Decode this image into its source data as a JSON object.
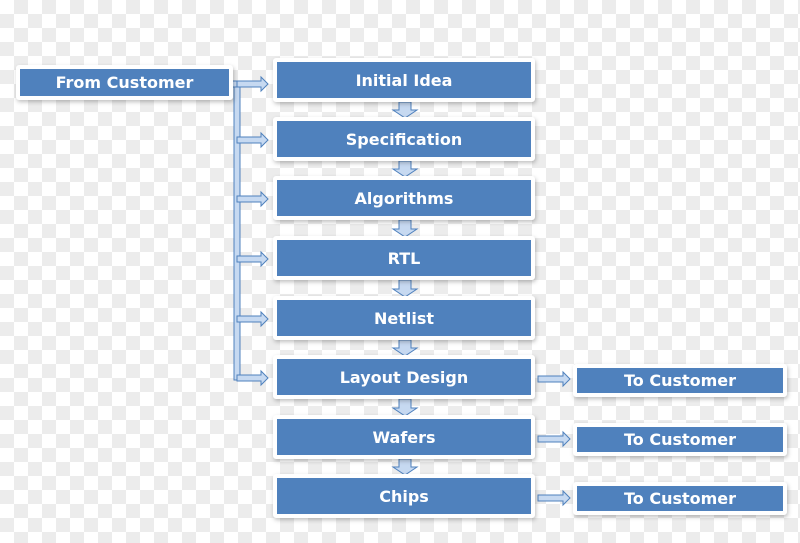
{
  "source": {
    "label": "From Customer"
  },
  "steps": [
    {
      "label": "Initial Idea"
    },
    {
      "label": "Specification"
    },
    {
      "label": "Algorithms"
    },
    {
      "label": "RTL"
    },
    {
      "label": "Netlist"
    },
    {
      "label": "Layout Design"
    },
    {
      "label": "Wafers"
    },
    {
      "label": "Chips"
    }
  ],
  "outputs": [
    {
      "from_step": "Layout Design",
      "label": "To Customer"
    },
    {
      "from_step": "Wafers",
      "label": "To Customer"
    },
    {
      "from_step": "Chips",
      "label": "To Customer"
    }
  ],
  "colors": {
    "box": "#4f81bd",
    "arrow_fill": "#c6d9f1",
    "arrow_stroke": "#4f81bd"
  }
}
